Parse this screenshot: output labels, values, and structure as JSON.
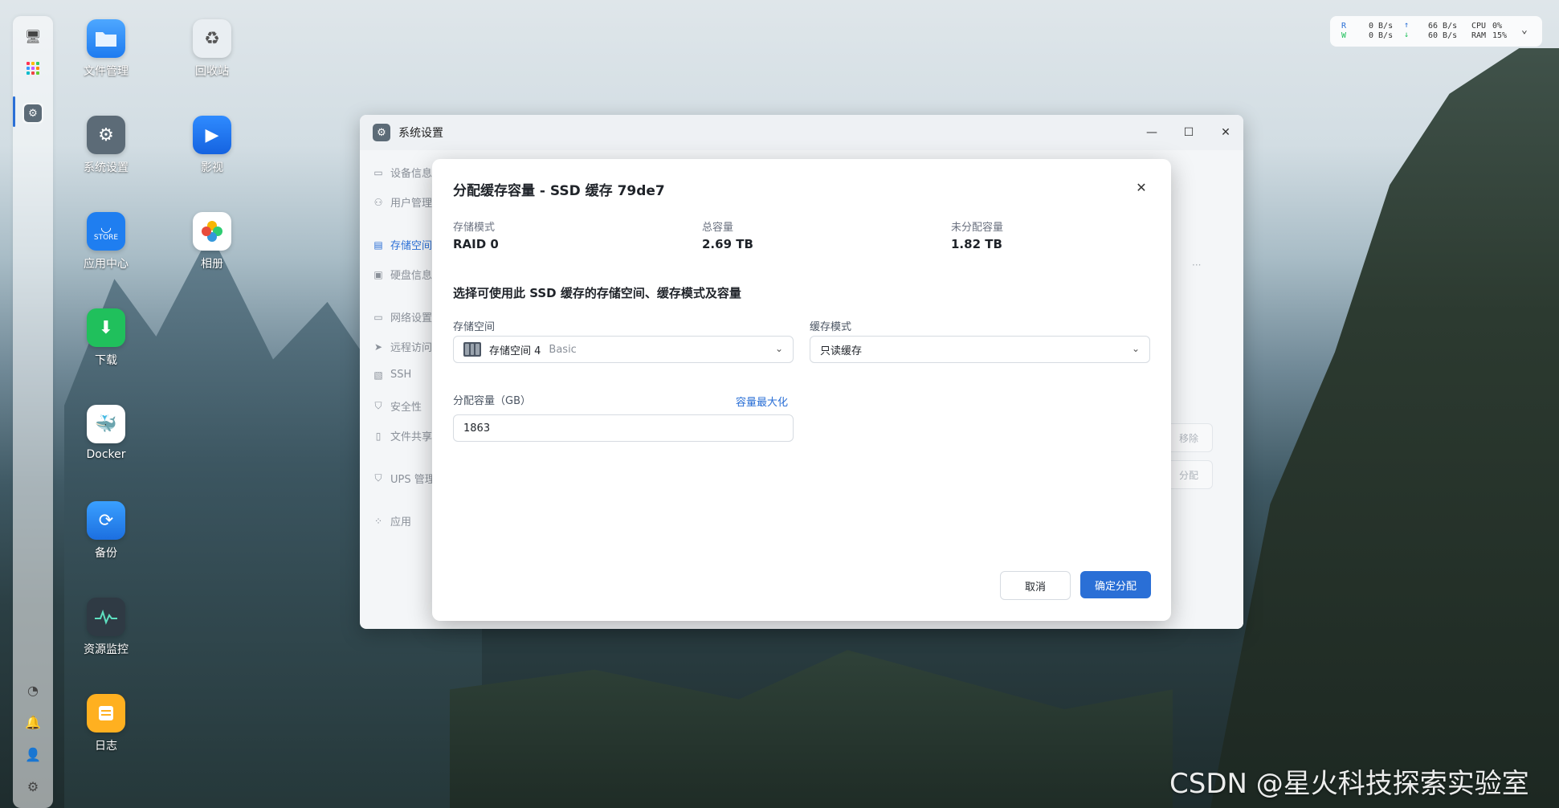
{
  "desktop": {
    "icons": [
      {
        "label": "文件管理",
        "icon": "folder-icon"
      },
      {
        "label": "回收站",
        "icon": "recycle-icon"
      },
      {
        "label": "系统设置",
        "icon": "gear-icon"
      },
      {
        "label": "影视",
        "icon": "video-icon"
      },
      {
        "label": "应用中心",
        "icon": "store-icon",
        "sub": "STORE"
      },
      {
        "label": "相册",
        "icon": "photos-icon"
      },
      {
        "label": "下载",
        "icon": "download-icon"
      },
      {
        "label": "Docker",
        "icon": "docker-icon"
      },
      {
        "label": "备份",
        "icon": "backup-icon"
      },
      {
        "label": "资源监控",
        "icon": "monitor-icon"
      },
      {
        "label": "日志",
        "icon": "log-icon"
      }
    ]
  },
  "network_widget": {
    "r_label": "R",
    "w_label": "W",
    "r_rate": "0 B/s",
    "w_rate": "0 B/s",
    "up_rate": "66 B/s",
    "down_rate": "60 B/s",
    "cpu_label": "CPU",
    "ram_label": "RAM",
    "cpu_value": "0%",
    "ram_value": "15%"
  },
  "window": {
    "title": "系统设置",
    "sidebar": [
      {
        "label": "设备信息",
        "icon": "device-icon"
      },
      {
        "label": "用户管理",
        "icon": "user-icon"
      },
      {
        "label": "存储空间",
        "icon": "storage-icon",
        "active": true
      },
      {
        "label": "硬盘信息",
        "icon": "disk-icon"
      },
      {
        "label": "网络设置",
        "icon": "network-icon"
      },
      {
        "label": "远程访问",
        "icon": "remote-icon"
      },
      {
        "label": "SSH",
        "icon": "ssh-icon"
      },
      {
        "label": "安全性",
        "icon": "shield-icon"
      },
      {
        "label": "文件共享",
        "icon": "share-icon"
      },
      {
        "label": "UPS 管理",
        "icon": "ups-icon"
      },
      {
        "label": "应用",
        "icon": "apps-icon"
      }
    ],
    "bg_buttons": {
      "remove": "移除",
      "allocate": "分配"
    },
    "more_label": "···"
  },
  "dialog": {
    "title": "分配缓存容量 - SSD 缓存 79de7",
    "stats": [
      {
        "key": "存储模式",
        "value": "RAID 0"
      },
      {
        "key": "总容量",
        "value": "2.69 TB"
      },
      {
        "key": "未分配容量",
        "value": "1.82 TB"
      }
    ],
    "section_title": "选择可使用此 SSD 缓存的存储空间、缓存模式及容量",
    "storage_label": "存储空间",
    "storage_value": "存储空间 4",
    "storage_type": "Basic",
    "cache_mode_label": "缓存模式",
    "cache_mode_value": "只读缓存",
    "capacity_label": "分配容量（GB）",
    "capacity_max_link": "容量最大化",
    "capacity_value": "1863",
    "cancel_label": "取消",
    "confirm_label": "确定分配"
  },
  "watermark": "CSDN @星火科技探索实验室",
  "colors": {
    "accent": "#2a6fd6"
  }
}
